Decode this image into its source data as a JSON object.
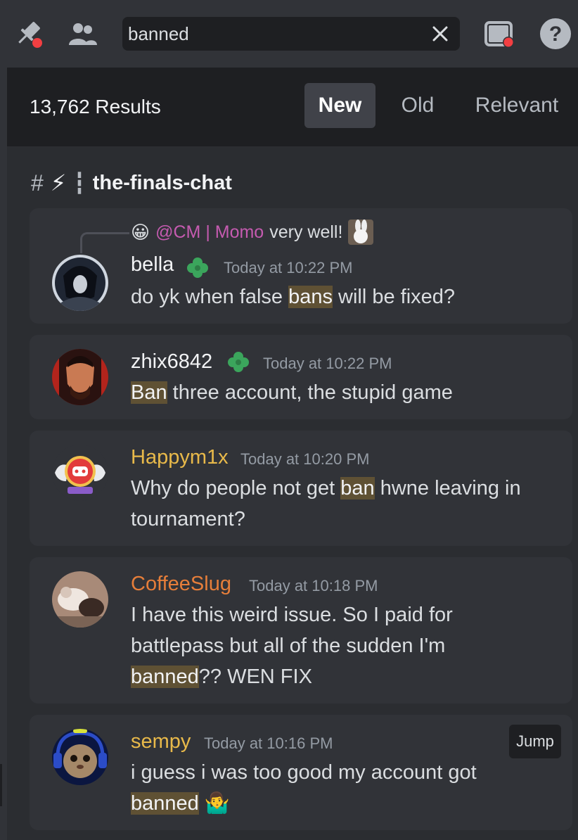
{
  "toolbar": {
    "icons": [
      "pin-icon",
      "members-icon",
      "inbox-icon",
      "help-icon"
    ],
    "search_value": "banned",
    "search_clear_icon": "close-icon"
  },
  "results": {
    "count_label": "13,762 Results",
    "sort_tabs": [
      {
        "label": "New",
        "active": true
      },
      {
        "label": "Old",
        "active": false
      },
      {
        "label": "Relevant",
        "active": false
      }
    ]
  },
  "channel": {
    "hash": "#",
    "emoji": "⚡",
    "separator": "┇",
    "name": "the-finals-chat"
  },
  "messages": [
    {
      "reply": {
        "emoji": "😀",
        "mention": "@CM | Momo",
        "text": "very well!",
        "image_icon": "bunny-image"
      },
      "username": "bella",
      "name_color": "#f2f3f5",
      "badge": "clover-badge-icon",
      "timestamp": "Today at 10:22 PM",
      "text_before": "do yk when false ",
      "highlight": "bans",
      "text_after": " will be fixed?"
    },
    {
      "username": "zhix6842",
      "name_color": "#f2f3f5",
      "badge": "clover-badge-icon",
      "timestamp": "Today at 10:22 PM",
      "text_before": "",
      "highlight": "Ban",
      "text_after": " three account, the stupid game"
    },
    {
      "username": "Happym1x",
      "name_color": "#e8b94a",
      "timestamp": "Today at 10:20 PM",
      "text_before": "Why do people not get ",
      "highlight": "ban",
      "text_after": " hwne leaving in tournament?"
    },
    {
      "username": "CoffeeSlug",
      "name_color": "#e67e3a",
      "timestamp": "Today at 10:18 PM",
      "text_before": "I have this weird issue. So I paid for battlepass but all of the sudden I'm ",
      "highlight": "banned",
      "text_after": "?? WEN FIX"
    },
    {
      "username": "sempy",
      "name_color": "#e8b94a",
      "timestamp": "Today at 10:16 PM",
      "text_before": "i guess i was too good my account got ",
      "highlight": "banned",
      "text_after": " 🤷‍♂️",
      "jump_label": "Jump"
    }
  ]
}
